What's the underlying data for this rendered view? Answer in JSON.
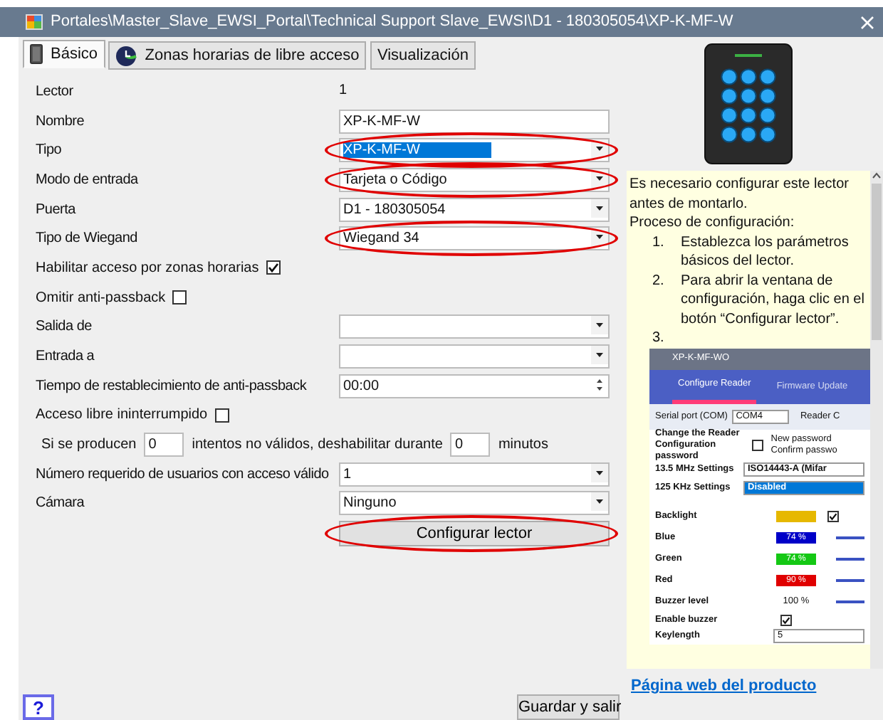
{
  "window": {
    "title": "Portales\\Master_Slave_EWSI_Portal\\Technical Support Slave_EWSI\\D1 - 180305054\\XP-K-MF-W"
  },
  "tabs": [
    {
      "label": "Básico",
      "selected": true,
      "kind": "reader"
    },
    {
      "label": "Zonas horarias de libre acceso",
      "selected": false,
      "kind": "clock"
    },
    {
      "label": "Visualización",
      "selected": false,
      "kind": "plain"
    }
  ],
  "form": [
    {
      "kind": "readonly",
      "label": "Lector",
      "value": "1"
    },
    {
      "kind": "text",
      "label": "Nombre",
      "value": "XP-K-MF-W"
    },
    {
      "kind": "select",
      "label": "Tipo",
      "value": "XP-K-MF-W",
      "highlighted": true,
      "annotated": true
    },
    {
      "kind": "select",
      "label": "Modo de entrada",
      "value": "Tarjeta o Código",
      "annotated": true
    },
    {
      "kind": "select",
      "label": "Puerta",
      "value": "D1 - 180305054"
    },
    {
      "kind": "select",
      "label": "Tipo de Wiegand",
      "value": "Wiegand 34",
      "annotated": true
    },
    {
      "kind": "checkbox",
      "label": "Habilitar acceso por zonas horarias",
      "checked": true
    },
    {
      "kind": "checkbox",
      "label": "Omitir anti-passback",
      "checked": false
    },
    {
      "kind": "select",
      "label": "Salida de"
    },
    {
      "kind": "select",
      "label": "Entrada a"
    },
    {
      "kind": "spin",
      "label": "Tiempo de restablecimiento de anti-passback",
      "value": "00:00"
    },
    {
      "kind": "checkbox",
      "label": "Acceso libre ininterrumpido",
      "checked": false
    },
    {
      "kind": "attempts",
      "label": "Si se producen",
      "first_value": "0",
      "middle_label": "intentos no válidos, deshabilitar durante",
      "second_value": "0",
      "end_label": "minutos"
    },
    {
      "kind": "select",
      "label": "Número requerido de usuarios con acceso válido",
      "value": "1"
    },
    {
      "kind": "select",
      "label": "Cámara",
      "value": "Ninguno"
    },
    {
      "kind": "button",
      "label": "Configurar lector",
      "annotated": true
    }
  ],
  "help": {
    "intro": "Es necesario configurar este lector antes de montarlo.",
    "heading": "Proceso de configuración:",
    "steps": [
      {
        "number": "1.",
        "text": "Establezca los parámetros básicos del lector."
      },
      {
        "number": "2.",
        "text": "Para abrir la ventana de configuración, haga clic en el botón “Configurar lector”."
      },
      {
        "number": "3."
      }
    ],
    "screenshot": {
      "title": "XP-K-MF-WO",
      "tabs": [
        {
          "label": "Configure Reader",
          "selected": true
        },
        {
          "label": "Firmware Update",
          "selected": false
        }
      ],
      "serial_label": "Serial port (COM)",
      "serial_value": "COM4",
      "reader_label": "Reader C",
      "password_label": "Change the Reader Configuration password",
      "password_checked": false,
      "new_password": "New password",
      "confirm_password": "Confirm passwo",
      "settings": [
        {
          "label": "13.5 MHz Settings",
          "value": "ISO14443-A (Mifar"
        },
        {
          "label": "125 KHz Settings",
          "value": "Disabled",
          "highlighted": true
        }
      ],
      "lights": [
        {
          "kind": "swatch",
          "label": "Backlight",
          "color": "#e6b800",
          "checked": true
        },
        {
          "kind": "level",
          "label": "Blue",
          "color": "#0000c8",
          "reading": "74 %"
        },
        {
          "kind": "level",
          "label": "Green",
          "color": "#14c814",
          "reading": "74 %"
        },
        {
          "kind": "level",
          "label": "Red",
          "color": "#e00000",
          "reading": "90 %"
        },
        {
          "kind": "plain",
          "label": "Buzzer level",
          "reading": "100 %"
        }
      ],
      "buzzer_label": "Enable buzzer",
      "buzzer_checked": true,
      "keylength_label": "Keylength",
      "keylength_value": "5"
    }
  },
  "product_link": "Página web del producto",
  "help_button": "?",
  "save_button": "Guardar y salir"
}
